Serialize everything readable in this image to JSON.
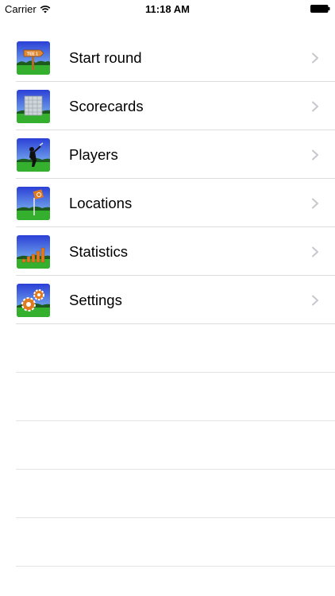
{
  "status_bar": {
    "carrier": "Carrier",
    "time": "11:18 AM"
  },
  "menu": {
    "items": [
      {
        "label": "Start round",
        "icon": "tee-sign-icon"
      },
      {
        "label": "Scorecards",
        "icon": "scorecard-icon"
      },
      {
        "label": "Players",
        "icon": "golfer-icon"
      },
      {
        "label": "Locations",
        "icon": "map-pin-flag-icon"
      },
      {
        "label": "Statistics",
        "icon": "bar-chart-icon"
      },
      {
        "label": "Settings",
        "icon": "gears-icon"
      }
    ]
  },
  "icon_tee_text": "TEE 1",
  "colors": {
    "sky_top": "#2b3fd6",
    "sky_bottom": "#7ec0f0",
    "grass": "#2fa82a",
    "accent_orange": "#e07a1f",
    "separator": "#dcdcdc",
    "chevron": "#c7c7cc"
  }
}
